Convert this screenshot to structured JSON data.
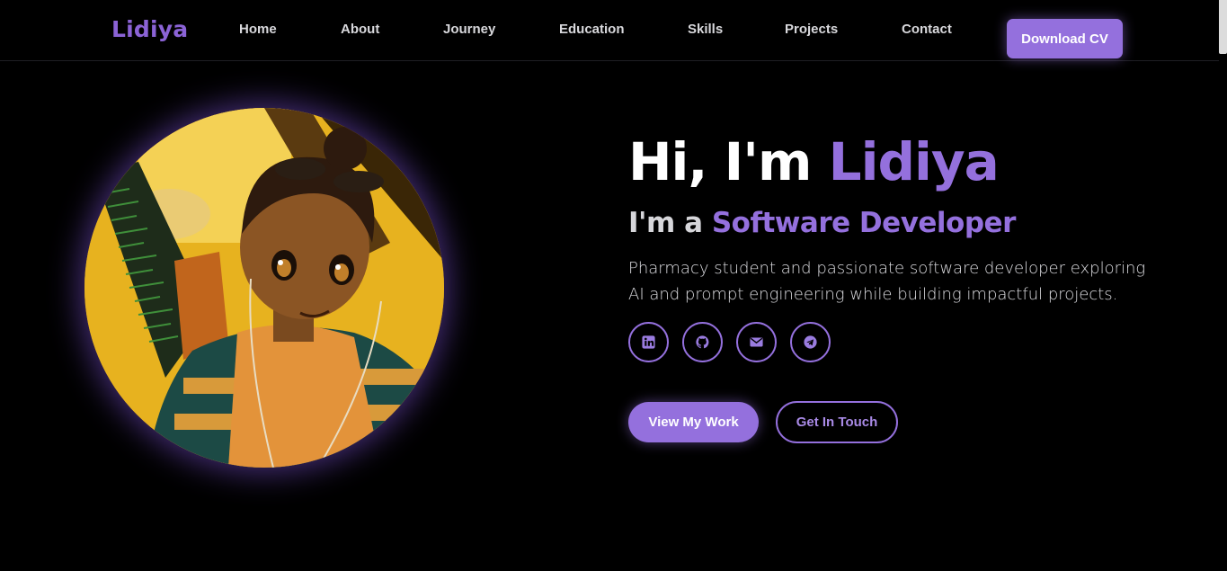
{
  "nav": {
    "brand": "Lidiya",
    "links": [
      "Home",
      "About",
      "Journey",
      "Education",
      "Skills",
      "Projects",
      "Contact"
    ],
    "download_cv": "Download CV"
  },
  "hero": {
    "greeting": "Hi, I'm ",
    "name": "Lidiya",
    "role_prefix": "I'm a ",
    "role": "Software Developer",
    "description": "Pharmacy student and passionate software developer exploring AI and prompt engineering while building impactful projects.",
    "socials": [
      "linkedin-icon",
      "github-icon",
      "email-icon",
      "telegram-icon"
    ],
    "view_work": "View My Work",
    "get_in_touch": "Get In Touch"
  },
  "colors": {
    "accent": "#9470dd",
    "background": "#000000"
  }
}
